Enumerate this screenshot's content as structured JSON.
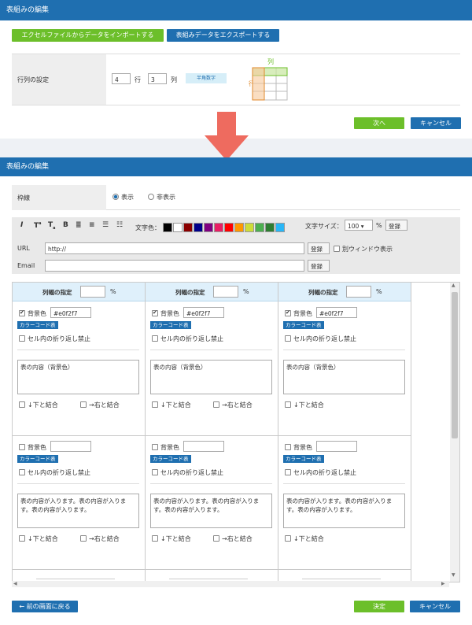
{
  "section1": {
    "title": "表組みの編集",
    "import_button": "エクセルファイルからデータをインポートする",
    "export_button": "表組みデータをエクスポートする",
    "rowcol_label": "行列の設定",
    "rows_value": "4",
    "rows_unit": "行",
    "cols_value": "3",
    "cols_unit": "列",
    "halfwidth_badge": "半角数字",
    "diagram_col_label": "列",
    "diagram_row_label": "行",
    "next_button": "次へ",
    "cancel_button": "キャンセル"
  },
  "section2": {
    "title": "表組みの編集",
    "border_label": "枠線",
    "show_option": "表示",
    "hide_option": "非表示",
    "text_color_label": "文字色：",
    "font_size_label": "文字サイズ：",
    "font_size_value": "100",
    "percent": "%",
    "register": "登録",
    "url_label": "URL",
    "url_value": "http://",
    "new_window_label": "別ウィンドウ表示",
    "email_label": "Email",
    "email_value": "",
    "swatches": [
      "#000000",
      "#ffffff",
      "#8b0000",
      "#00008b",
      "#800080",
      "#e91e63",
      "#ff0000",
      "#ff9800",
      "#cddc39",
      "#4caf50",
      "#2e7d32",
      "#29b6f6"
    ],
    "col_width_label": "列幅の指定",
    "bg_color_label": "背景色",
    "color_code_button": "カラーコード表",
    "no_wrap_label": "セル内の折り返し禁止",
    "merge_down_label": "↓下と結合",
    "merge_right_label": "→右と結合",
    "row1_bg_value": "#e0f2f7",
    "row1_text": "表の内容（背景色）",
    "row2_text": "表の内容が入ります。表の内容が入ります。表の内容が入ります。",
    "back_button": "← 前の画面に戻る",
    "decide_button": "決定",
    "cancel_button": "キャンセル"
  }
}
